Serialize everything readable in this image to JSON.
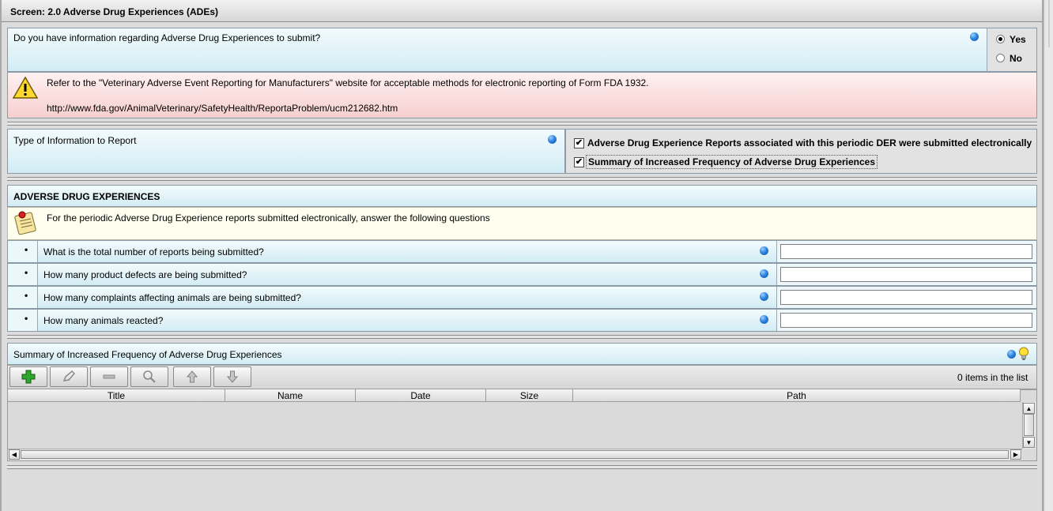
{
  "screen_title": "Screen: 2.0 Adverse Drug Experiences (ADEs)",
  "question_ade": {
    "text": "Do you have information regarding Adverse Drug Experiences to submit?",
    "options": [
      {
        "label": "Yes",
        "selected": true
      },
      {
        "label": "No",
        "selected": false
      }
    ]
  },
  "warning": {
    "text": "Refer to the \"Veterinary Adverse Event Reporting for Manufacturers\" website for acceptable methods for electronic reporting of Form FDA 1932.",
    "url": "http://www.fda.gov/AnimalVeterinary/SafetyHealth/ReportaProblem/ucm212682.htm"
  },
  "info_type": {
    "label": "Type of Information to Report",
    "options": [
      {
        "label": "Adverse Drug Experience Reports associated with this periodic DER were submitted electronically",
        "checked": true
      },
      {
        "label": "Summary of Increased Frequency of Adverse Drug Experiences",
        "checked": true
      }
    ]
  },
  "ade_section": {
    "title": "ADVERSE DRUG EXPERIENCES",
    "note": "For the periodic Adverse Drug Experience reports submitted electronically, answer the following questions",
    "bullet": "•",
    "questions": [
      {
        "text": "What is the total number of reports being submitted?",
        "value": ""
      },
      {
        "text": "How many product defects are being submitted?",
        "value": ""
      },
      {
        "text": "How many complaints affecting animals are being submitted?",
        "value": ""
      },
      {
        "text": "How many animals reacted?",
        "value": ""
      }
    ]
  },
  "summary": {
    "title": "Summary of Increased Frequency of Adverse Drug Experiences",
    "count_text": "0 items in the list",
    "toolbar": [
      "add-icon",
      "edit-icon",
      "remove-icon",
      "view-icon",
      "move-up-icon",
      "move-down-icon"
    ],
    "columns": [
      "Title",
      "Name",
      "Date",
      "Size",
      "Path"
    ]
  },
  "colors": {
    "accent_blue": "#2e86e0",
    "warning_bg": "#f6cfcf",
    "panel_blue": "#d2ecf4",
    "add_green": "#2fa52f"
  }
}
